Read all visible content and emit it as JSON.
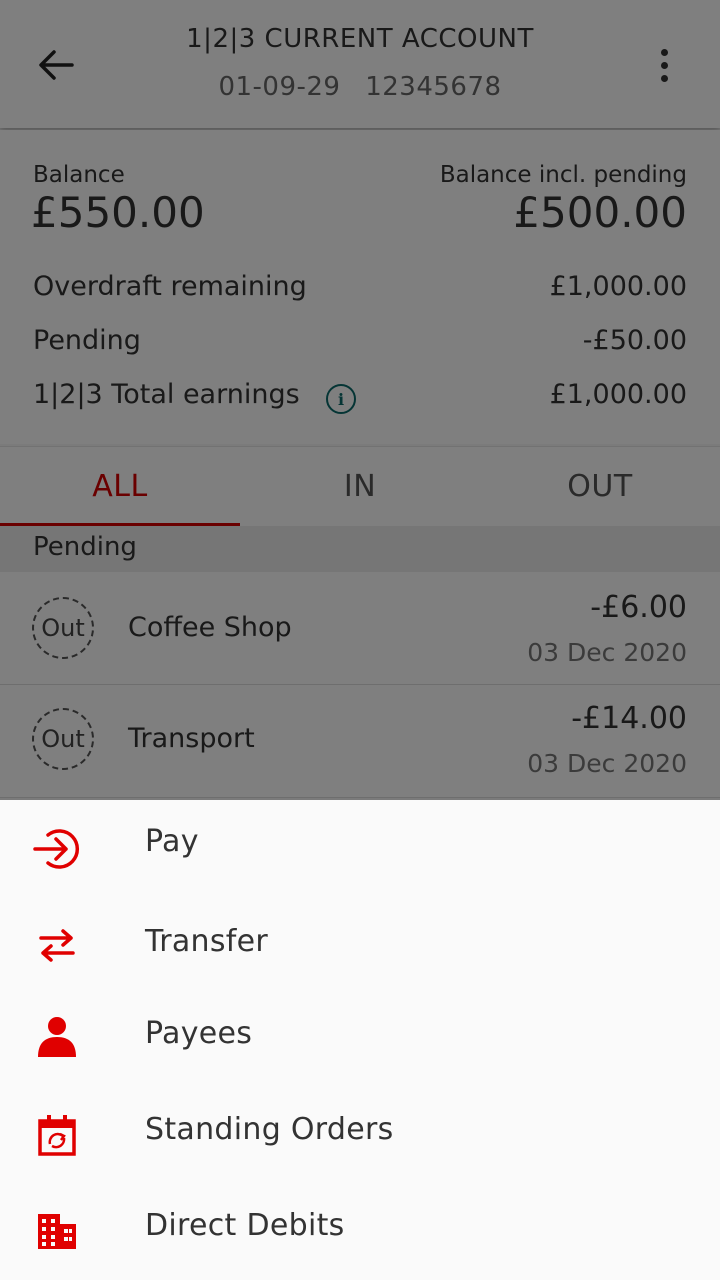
{
  "header": {
    "title": "1|2|3 CURRENT ACCOUNT",
    "sort_code": "01-09-29",
    "account_number": "12345678",
    "back_icon": "arrow-left-icon",
    "more_icon": "more-vertical-icon"
  },
  "summary": {
    "balance_label": "Balance",
    "balance_value": "£550.00",
    "pending_balance_label": "Balance incl. pending",
    "pending_balance_value": "£500.00",
    "rows": [
      {
        "label": "Overdraft remaining",
        "value": "£1,000.00"
      },
      {
        "label": "Pending",
        "value": "-£50.00"
      },
      {
        "label": "1|2|3 Total earnings",
        "value": "£1,000.00"
      }
    ]
  },
  "tabs": [
    {
      "label": "ALL",
      "active": true
    },
    {
      "label": "IN",
      "active": false
    },
    {
      "label": "OUT",
      "active": false
    }
  ],
  "pending_section": {
    "header": "Pending",
    "transactions": [
      {
        "badge": "Out",
        "name": "Coffee Shop",
        "amount": "-£6.00",
        "date": "03 Dec 2020"
      },
      {
        "badge": "Out",
        "name": "Transport",
        "amount": "-£14.00",
        "date": "03 Dec 2020"
      }
    ]
  },
  "action_sheet": {
    "items": [
      {
        "label": "Pay",
        "icon": "pay-icon"
      },
      {
        "label": "Transfer",
        "icon": "transfer-arrows-icon"
      },
      {
        "label": "Payees",
        "icon": "person-icon"
      },
      {
        "label": "Standing Orders",
        "icon": "calendar-repeat-icon"
      },
      {
        "label": "Direct Debits",
        "icon": "building-icon"
      }
    ]
  },
  "colors": {
    "accent": "#d40000",
    "info": "#0b6b6b",
    "scrim": "rgba(0,0,0,0.5)"
  }
}
